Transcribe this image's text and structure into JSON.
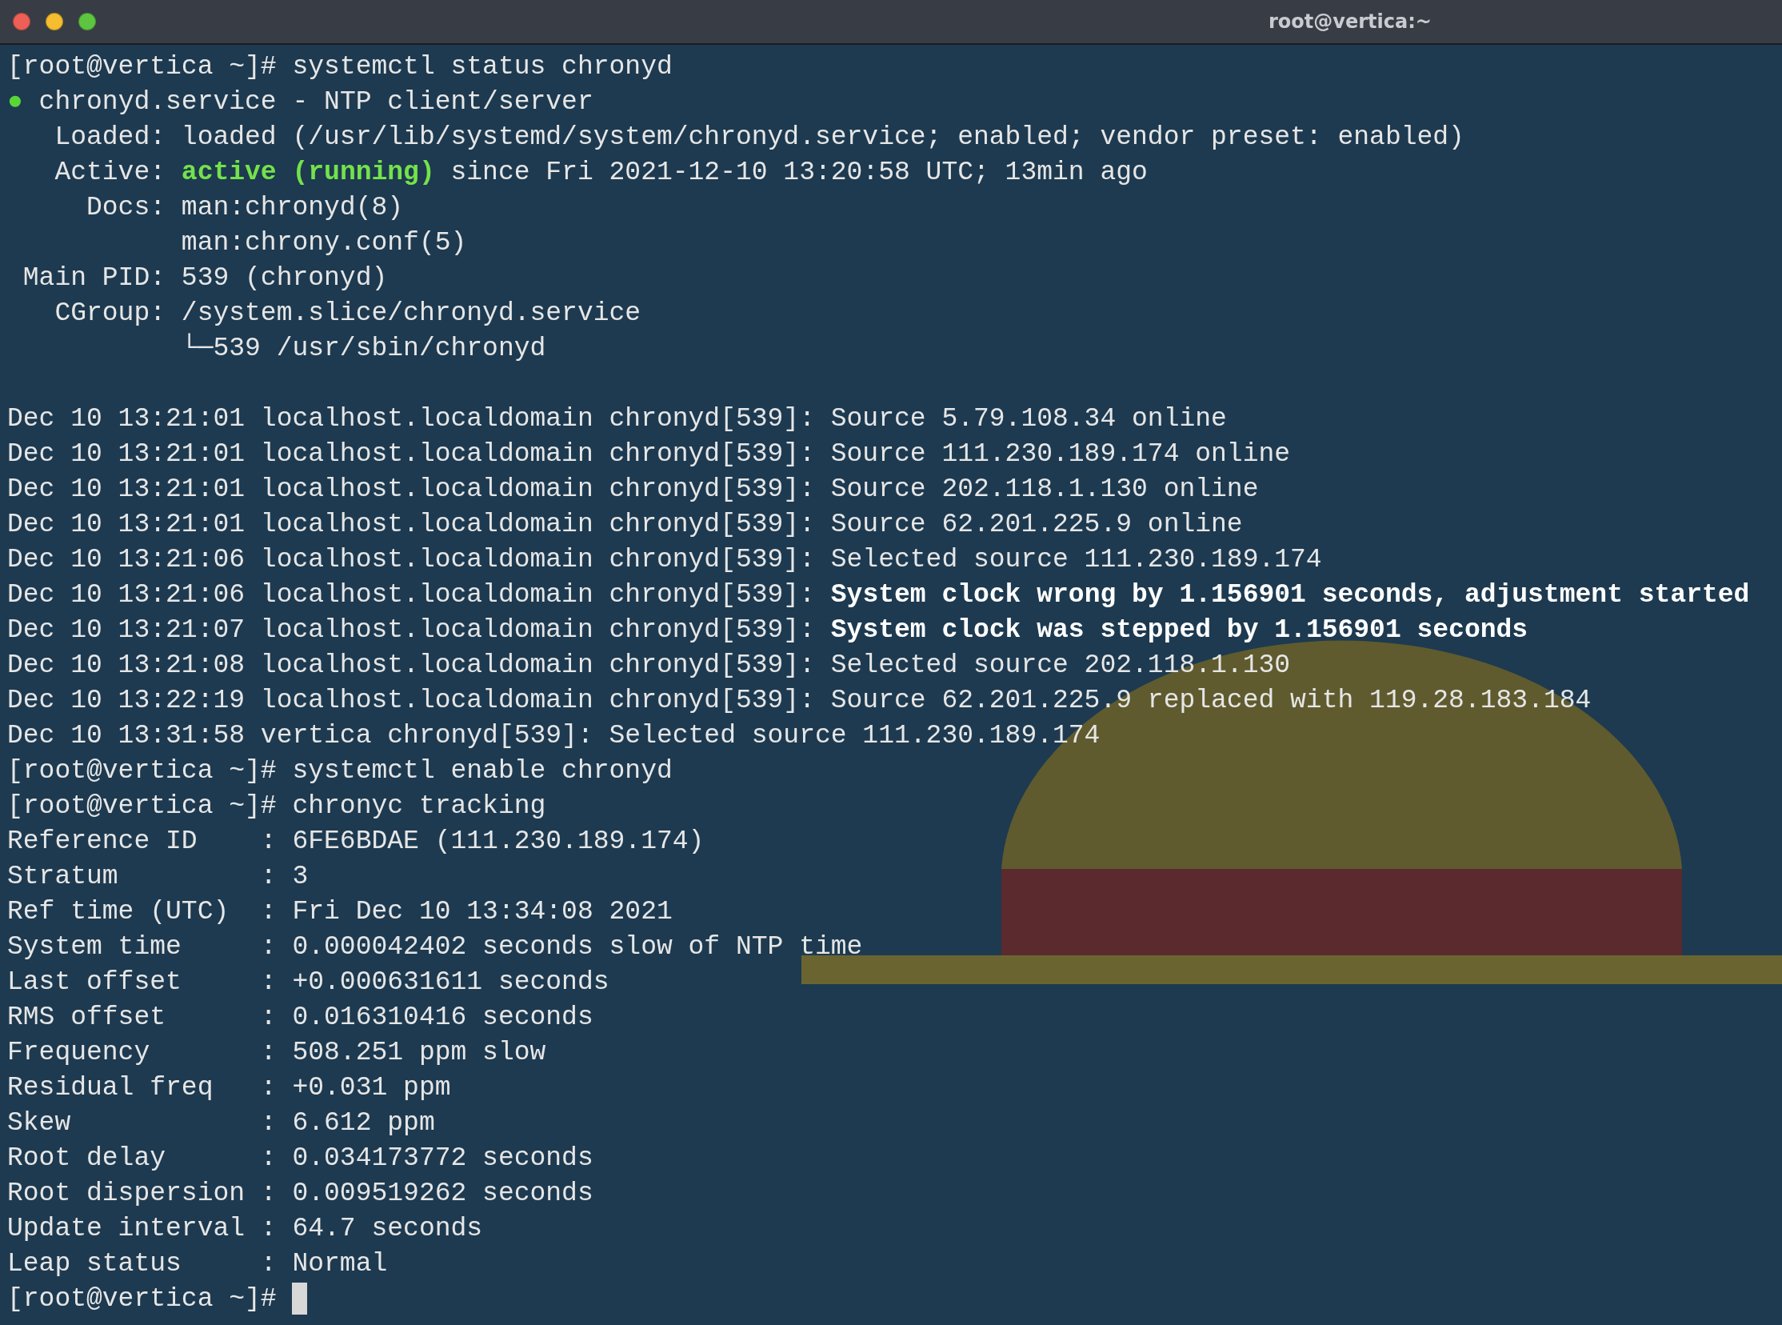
{
  "window": {
    "title": "root@vertica:~"
  },
  "lines": [
    {
      "kind": "text",
      "segments": [
        {
          "kind": "plain",
          "text": "[root@vertica ~]# systemctl status chronyd"
        }
      ]
    },
    {
      "kind": "text",
      "segments": [
        {
          "kind": "dot",
          "text": "●"
        },
        {
          "kind": "plain",
          "text": " chronyd.service - NTP client/server"
        }
      ]
    },
    {
      "kind": "text",
      "segments": [
        {
          "kind": "plain",
          "text": "   Loaded: loaded (/usr/lib/systemd/system/chronyd.service; enabled; vendor preset: enabled)"
        }
      ]
    },
    {
      "kind": "text",
      "segments": [
        {
          "kind": "plain",
          "text": "   Active: "
        },
        {
          "kind": "highlight",
          "text": "active (running)"
        },
        {
          "kind": "plain",
          "text": " since Fri 2021-12-10 13:20:58 UTC; 13min ago"
        }
      ]
    },
    {
      "kind": "text",
      "segments": [
        {
          "kind": "plain",
          "text": "     Docs: man:chronyd(8)"
        }
      ]
    },
    {
      "kind": "text",
      "segments": [
        {
          "kind": "plain",
          "text": "           man:chrony.conf(5)"
        }
      ]
    },
    {
      "kind": "text",
      "segments": [
        {
          "kind": "plain",
          "text": " Main PID: 539 (chronyd)"
        }
      ]
    },
    {
      "kind": "text",
      "segments": [
        {
          "kind": "plain",
          "text": "   CGroup: /system.slice/chronyd.service"
        }
      ]
    },
    {
      "kind": "text",
      "segments": [
        {
          "kind": "plain",
          "text": "           └─539 /usr/sbin/chronyd"
        }
      ]
    },
    {
      "kind": "blank"
    },
    {
      "kind": "text",
      "segments": [
        {
          "kind": "plain",
          "text": "Dec 10 13:21:01 localhost.localdomain chronyd[539]: Source 5.79.108.34 online"
        }
      ]
    },
    {
      "kind": "text",
      "segments": [
        {
          "kind": "plain",
          "text": "Dec 10 13:21:01 localhost.localdomain chronyd[539]: Source 111.230.189.174 online"
        }
      ]
    },
    {
      "kind": "text",
      "segments": [
        {
          "kind": "plain",
          "text": "Dec 10 13:21:01 localhost.localdomain chronyd[539]: Source 202.118.1.130 online"
        }
      ]
    },
    {
      "kind": "text",
      "segments": [
        {
          "kind": "plain",
          "text": "Dec 10 13:21:01 localhost.localdomain chronyd[539]: Source 62.201.225.9 online"
        }
      ]
    },
    {
      "kind": "text",
      "segments": [
        {
          "kind": "plain",
          "text": "Dec 10 13:21:06 localhost.localdomain chronyd[539]: Selected source 111.230.189.174"
        }
      ]
    },
    {
      "kind": "text",
      "segments": [
        {
          "kind": "plain",
          "text": "Dec 10 13:21:06 localhost.localdomain chronyd[539]: "
        },
        {
          "kind": "bold",
          "text": "System clock wrong by 1.156901 seconds, adjustment started"
        }
      ]
    },
    {
      "kind": "text",
      "segments": [
        {
          "kind": "plain",
          "text": "Dec 10 13:21:07 localhost.localdomain chronyd[539]: "
        },
        {
          "kind": "bold",
          "text": "System clock was stepped by 1.156901 seconds"
        }
      ]
    },
    {
      "kind": "text",
      "segments": [
        {
          "kind": "plain",
          "text": "Dec 10 13:21:08 localhost.localdomain chronyd[539]: Selected source 202.118.1.130"
        }
      ]
    },
    {
      "kind": "text",
      "segments": [
        {
          "kind": "plain",
          "text": "Dec 10 13:22:19 localhost.localdomain chronyd[539]: Source 62.201.225.9 replaced with 119.28.183.184"
        }
      ]
    },
    {
      "kind": "text",
      "segments": [
        {
          "kind": "plain",
          "text": "Dec 10 13:31:58 vertica chronyd[539]: Selected source 111.230.189.174"
        }
      ]
    },
    {
      "kind": "text",
      "segments": [
        {
          "kind": "plain",
          "text": "[root@vertica ~]# systemctl enable chronyd"
        }
      ]
    },
    {
      "kind": "text",
      "segments": [
        {
          "kind": "plain",
          "text": "[root@vertica ~]# chronyc tracking"
        }
      ]
    },
    {
      "kind": "text",
      "segments": [
        {
          "kind": "plain",
          "text": "Reference ID    : 6FE6BDAE (111.230.189.174)"
        }
      ]
    },
    {
      "kind": "text",
      "segments": [
        {
          "kind": "plain",
          "text": "Stratum         : 3"
        }
      ]
    },
    {
      "kind": "text",
      "segments": [
        {
          "kind": "plain",
          "text": "Ref time (UTC)  : Fri Dec 10 13:34:08 2021"
        }
      ]
    },
    {
      "kind": "text",
      "segments": [
        {
          "kind": "plain",
          "text": "System time     : 0.000042402 seconds slow of NTP time"
        }
      ]
    },
    {
      "kind": "text",
      "segments": [
        {
          "kind": "plain",
          "text": "Last offset     : +0.000631611 seconds"
        }
      ]
    },
    {
      "kind": "text",
      "segments": [
        {
          "kind": "plain",
          "text": "RMS offset      : 0.016310416 seconds"
        }
      ]
    },
    {
      "kind": "text",
      "segments": [
        {
          "kind": "plain",
          "text": "Frequency       : 508.251 ppm slow"
        }
      ]
    },
    {
      "kind": "text",
      "segments": [
        {
          "kind": "plain",
          "text": "Residual freq   : +0.031 ppm"
        }
      ]
    },
    {
      "kind": "text",
      "segments": [
        {
          "kind": "plain",
          "text": "Skew            : 6.612 ppm"
        }
      ]
    },
    {
      "kind": "text",
      "segments": [
        {
          "kind": "plain",
          "text": "Root delay      : 0.034173772 seconds"
        }
      ]
    },
    {
      "kind": "text",
      "segments": [
        {
          "kind": "plain",
          "text": "Root dispersion : 0.009519262 seconds"
        }
      ]
    },
    {
      "kind": "text",
      "segments": [
        {
          "kind": "plain",
          "text": "Update interval : 64.7 seconds"
        }
      ]
    },
    {
      "kind": "text",
      "segments": [
        {
          "kind": "plain",
          "text": "Leap status     : Normal"
        }
      ]
    },
    {
      "kind": "prompt",
      "segments": [
        {
          "kind": "plain",
          "text": "[root@vertica ~]# "
        }
      ]
    }
  ]
}
